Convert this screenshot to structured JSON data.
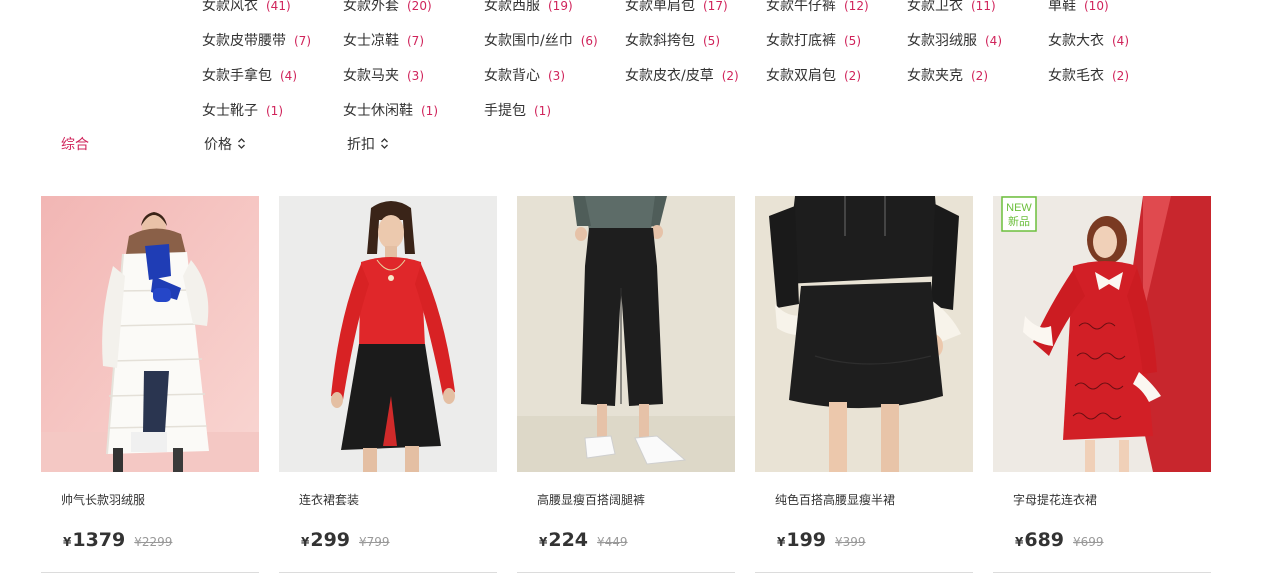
{
  "categories": [
    {
      "label": "女款风衣",
      "count": "(41)"
    },
    {
      "label": "女款外套",
      "count": "(20)"
    },
    {
      "label": "女款西服",
      "count": "(19)"
    },
    {
      "label": "女款单肩包",
      "count": "(17)"
    },
    {
      "label": "女款牛仔裤",
      "count": "(12)"
    },
    {
      "label": "女款卫衣",
      "count": "(11)"
    },
    {
      "label": "单鞋",
      "count": "(10)"
    },
    {
      "label": "女款皮带腰带",
      "count": "(7)"
    },
    {
      "label": "女士凉鞋",
      "count": "(7)"
    },
    {
      "label": "女款围巾/丝巾",
      "count": "(6)"
    },
    {
      "label": "女款斜挎包",
      "count": "(5)"
    },
    {
      "label": "女款打底裤",
      "count": "(5)"
    },
    {
      "label": "女款羽绒服",
      "count": "(4)"
    },
    {
      "label": "女款大衣",
      "count": "(4)"
    },
    {
      "label": "女款手拿包",
      "count": "(4)"
    },
    {
      "label": "女款马夹",
      "count": "(3)"
    },
    {
      "label": "女款背心",
      "count": "(3)"
    },
    {
      "label": "女款皮衣/皮草",
      "count": "(2)"
    },
    {
      "label": "女款双肩包",
      "count": "(2)"
    },
    {
      "label": "女款夹克",
      "count": "(2)"
    },
    {
      "label": "女款毛衣",
      "count": "(2)"
    },
    {
      "label": "女士靴子",
      "count": "(1)"
    },
    {
      "label": "女士休闲鞋",
      "count": "(1)"
    },
    {
      "label": "手提包",
      "count": "(1)"
    }
  ],
  "sort": {
    "comprehensive": "综合",
    "price": "价格",
    "discount": "折扣"
  },
  "colors": {
    "accent": "#d0245b",
    "text": "#333333",
    "muted": "#999999"
  },
  "products": [
    {
      "name": "帅气长款羽绒服",
      "currency": "¥",
      "price": "1379",
      "original": "¥2299"
    },
    {
      "name": "连衣裙套装",
      "currency": "¥",
      "price": "299",
      "original": "¥799"
    },
    {
      "name": "高腰显瘦百搭阔腿裤",
      "currency": "¥",
      "price": "224",
      "original": "¥449"
    },
    {
      "name": "纯色百搭高腰显瘦半裙",
      "currency": "¥",
      "price": "199",
      "original": "¥399"
    },
    {
      "name": "字母提花连衣裙",
      "currency": "¥",
      "price": "689",
      "original": "¥699",
      "badge_top": "NEW",
      "badge_bottom": "新品"
    }
  ]
}
